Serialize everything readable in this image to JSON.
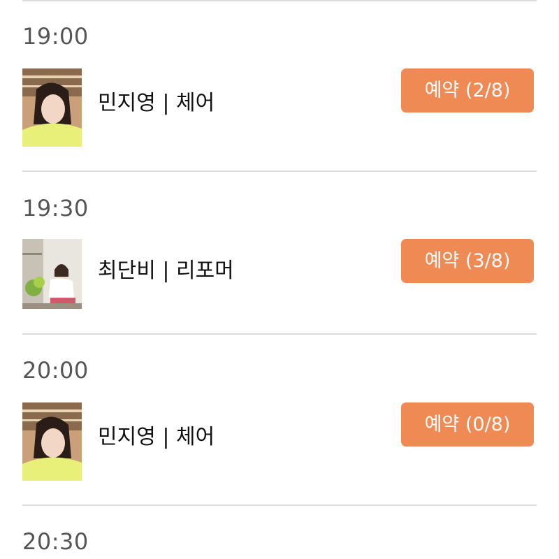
{
  "schedule": {
    "slots": [
      {
        "time": "19:00",
        "instructor": "민지영 | 체어",
        "button_label": "예약 (2/8)",
        "avatar": "instructor-photo-a"
      },
      {
        "time": "19:30",
        "instructor": "최단비 | 리포머",
        "button_label": "예약 (3/8)",
        "avatar": "instructor-photo-b"
      },
      {
        "time": "20:00",
        "instructor": "민지영 | 체어",
        "button_label": "예약 (0/8)",
        "avatar": "instructor-photo-a"
      },
      {
        "time": "20:30"
      }
    ]
  },
  "colors": {
    "button_bg": "#f08a55",
    "button_text": "#ffffff",
    "divider": "#dcdcdc",
    "time_text": "#555555",
    "instructor_text": "#111111"
  }
}
